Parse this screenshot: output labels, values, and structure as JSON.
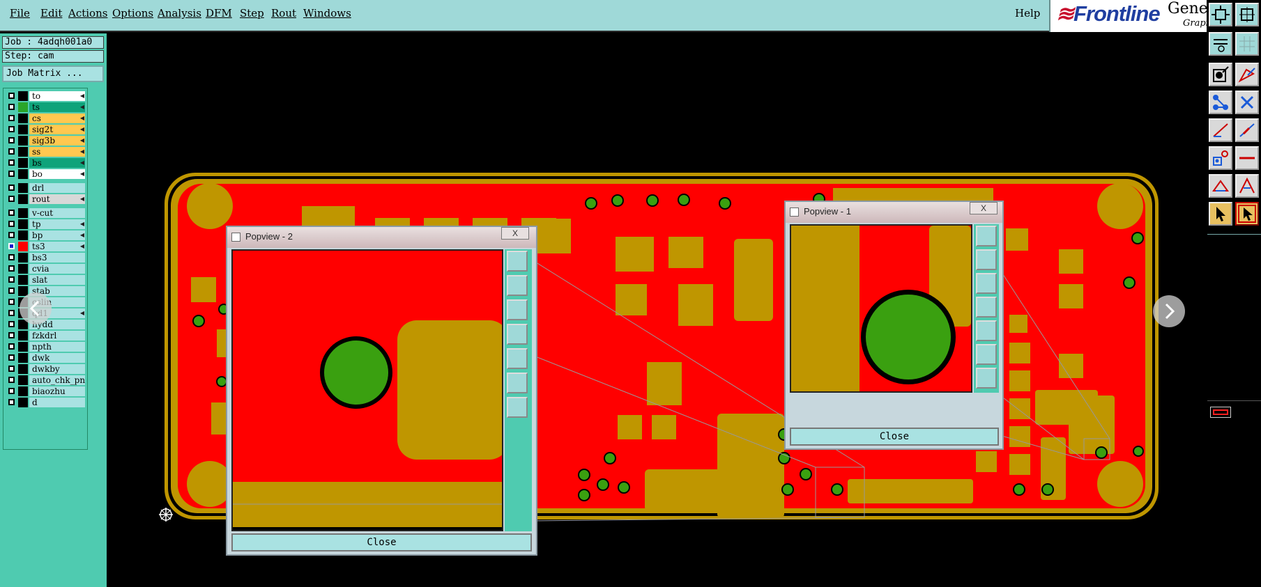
{
  "menubar": {
    "items": [
      {
        "label": "File"
      },
      {
        "label": "Edit"
      },
      {
        "label": "Actions"
      },
      {
        "label": "Options"
      },
      {
        "label": "Analysis"
      },
      {
        "label": "DFM"
      },
      {
        "label": "Step"
      },
      {
        "label": "Rout"
      },
      {
        "label": "Windows"
      }
    ],
    "help": "Help"
  },
  "brand": {
    "name": "Frontline",
    "side": "Genes",
    "sub": "Grapi"
  },
  "left": {
    "job": "Job : 4adqh001a0",
    "step": "Step: cam",
    "job_matrix": "Job Matrix ...",
    "layers": [
      {
        "name": "to",
        "color": "#ffffff",
        "swatch": "#000000",
        "arrow": true,
        "selected": false
      },
      {
        "name": "ts",
        "color": "#0fa37a",
        "swatch": "#2aa52a",
        "arrow": true,
        "selected": false
      },
      {
        "name": "cs",
        "color": "#ffc850",
        "swatch": "#000000",
        "arrow": true,
        "selected": false
      },
      {
        "name": "sig2t",
        "color": "#ffc850",
        "swatch": "#000000",
        "arrow": true,
        "selected": false
      },
      {
        "name": "sig3b",
        "color": "#ffc850",
        "swatch": "#000000",
        "arrow": true,
        "selected": false
      },
      {
        "name": "ss",
        "color": "#ffc850",
        "swatch": "#000000",
        "arrow": true,
        "selected": false
      },
      {
        "name": "bs",
        "color": "#0fa37a",
        "swatch": "#000000",
        "arrow": true,
        "selected": false
      },
      {
        "name": "bo",
        "color": "#ffffff",
        "swatch": "#000000",
        "arrow": true,
        "selected": false
      },
      {
        "name": "drl",
        "color": "#a9e2e2",
        "swatch": "#000000",
        "arrow": false,
        "selected": false
      },
      {
        "name": "rout",
        "color": "#d8d8d8",
        "swatch": "#000000",
        "arrow": true,
        "selected": false
      },
      {
        "name": "v-cut",
        "color": "#a9e2e2",
        "swatch": "#000000",
        "arrow": false,
        "selected": false
      },
      {
        "name": "tp",
        "color": "#a9e2e2",
        "swatch": "#000000",
        "arrow": true,
        "selected": false
      },
      {
        "name": "bp",
        "color": "#a9e2e2",
        "swatch": "#000000",
        "arrow": true,
        "selected": false
      },
      {
        "name": "ts3",
        "color": "#a9e2e2",
        "swatch": "#ff0000",
        "arrow": true,
        "selected": true
      },
      {
        "name": "bs3",
        "color": "#a9e2e2",
        "swatch": "#000000",
        "arrow": false,
        "selected": false
      },
      {
        "name": "cvia",
        "color": "#a9e2e2",
        "swatch": "#000000",
        "arrow": false,
        "selected": false
      },
      {
        "name": "slat",
        "color": "#a9e2e2",
        "swatch": "#000000",
        "arrow": false,
        "selected": false
      },
      {
        "name": "stab",
        "color": "#a9e2e2",
        "swatch": "#000000",
        "arrow": false,
        "selected": false
      },
      {
        "name": "cslin",
        "color": "#a9e2e2",
        "swatch": "#000000",
        "arrow": false,
        "selected": false
      },
      {
        "name": "qd1",
        "color": "#a9e2e2",
        "swatch": "#000000",
        "arrow": true,
        "selected": false
      },
      {
        "name": "hydd",
        "color": "#a9e2e2",
        "swatch": "#000000",
        "arrow": false,
        "selected": false
      },
      {
        "name": "fzkdrl",
        "color": "#a9e2e2",
        "swatch": "#000000",
        "arrow": false,
        "selected": false
      },
      {
        "name": "npth",
        "color": "#a9e2e2",
        "swatch": "#000000",
        "arrow": false,
        "selected": false
      },
      {
        "name": "dwk",
        "color": "#a9e2e2",
        "swatch": "#000000",
        "arrow": false,
        "selected": false
      },
      {
        "name": "dwkby",
        "color": "#a9e2e2",
        "swatch": "#000000",
        "arrow": false,
        "selected": false
      },
      {
        "name": "auto_chk_pn",
        "color": "#a9e2e2",
        "swatch": "#000000",
        "arrow": false,
        "selected": false
      },
      {
        "name": "biaozhu",
        "color": "#a9e2e2",
        "swatch": "#000000",
        "arrow": false,
        "selected": false
      },
      {
        "name": "d",
        "color": "#a9e2e2",
        "swatch": "#000000",
        "arrow": false,
        "selected": false
      }
    ]
  },
  "popview2": {
    "title": "Popview - 2",
    "close": "Close",
    "x_label": "X"
  },
  "popview1": {
    "title": "Popview - 1",
    "close": "Close",
    "x_label": "X"
  },
  "colors": {
    "board_red": "#ff0000",
    "copper": "#bf9600",
    "pad_green": "#3aa010",
    "menu_teal": "#9fd9d8",
    "panel_teal": "#4fcbb0"
  }
}
